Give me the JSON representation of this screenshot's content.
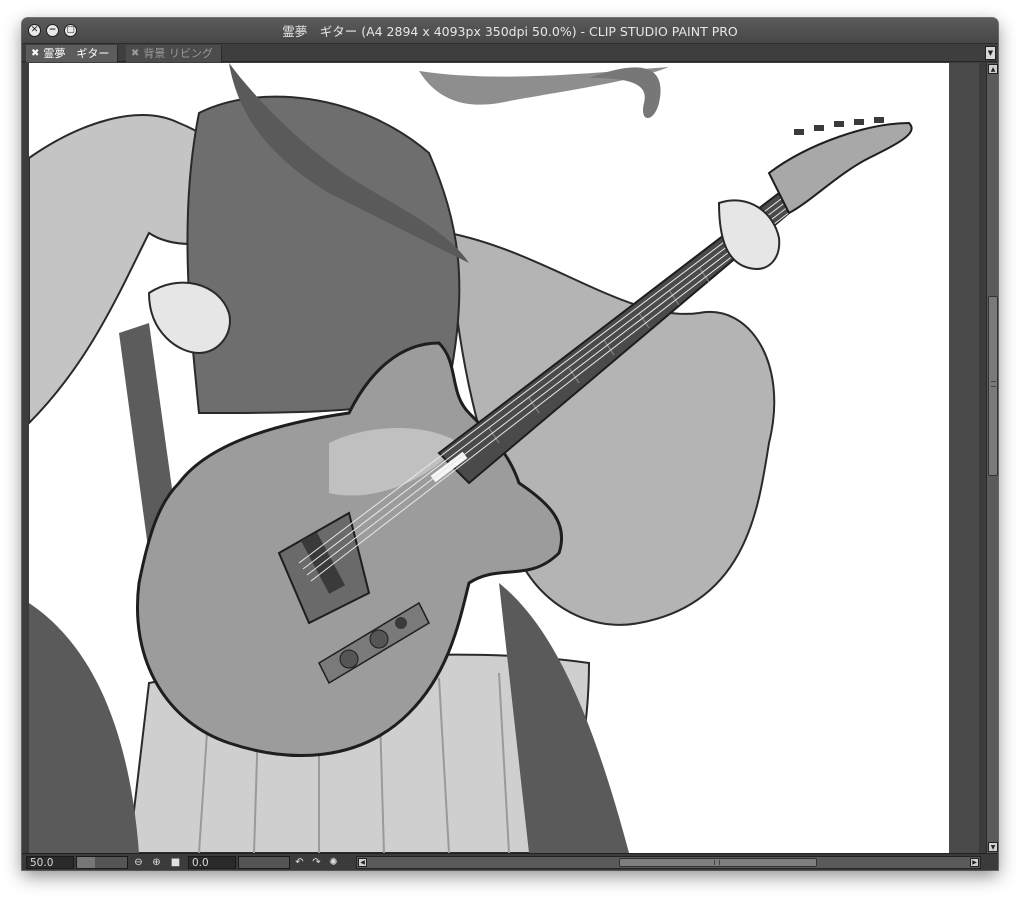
{
  "window": {
    "title": "霊夢　ギター (A4 2894 x 4093px 350dpi 50.0%)  - CLIP STUDIO PAINT PRO",
    "controls": [
      {
        "icon": "close-icon",
        "glyph": "✕"
      },
      {
        "icon": "minimize-icon",
        "glyph": "−"
      },
      {
        "icon": "maximize-icon",
        "glyph": "▢"
      }
    ]
  },
  "tabs": [
    {
      "label": "霊夢　ギター",
      "close_glyph": "✖",
      "active": true
    },
    {
      "label": "背景 リビング",
      "close_glyph": "✖",
      "active": false
    }
  ],
  "tab_dropdown_glyph": "▼",
  "canvas": {
    "content": "grayscale illustration of a girl in shrine-maiden style clothing playing a telecaster-style electric guitar"
  },
  "statusbar": {
    "zoom_value": "50.0",
    "zoom_slider_level": 0.35,
    "zoom_out_icon": "zoom-out-icon",
    "zoom_in_icon": "zoom-in-icon",
    "fit_icon": "fit-screen-icon",
    "rotation_value": "0.0",
    "rotation_slider_level": 0.0,
    "rotate_left_icon": "rotate-left-icon",
    "rotate_right_icon": "rotate-right-icon",
    "reset_rotation_icon": "reset-rotation-icon",
    "hscroll_left_glyph": "◀",
    "hscroll_right_glyph": "▶"
  },
  "vscroll": {
    "up_glyph": "▲",
    "down_glyph": "▼"
  },
  "colors": {
    "window_bg": "#3c3c3c",
    "canvas_bg": "#ffffff",
    "tab_active": "#5c5c5c",
    "tab_inactive": "#4c4c4c"
  }
}
